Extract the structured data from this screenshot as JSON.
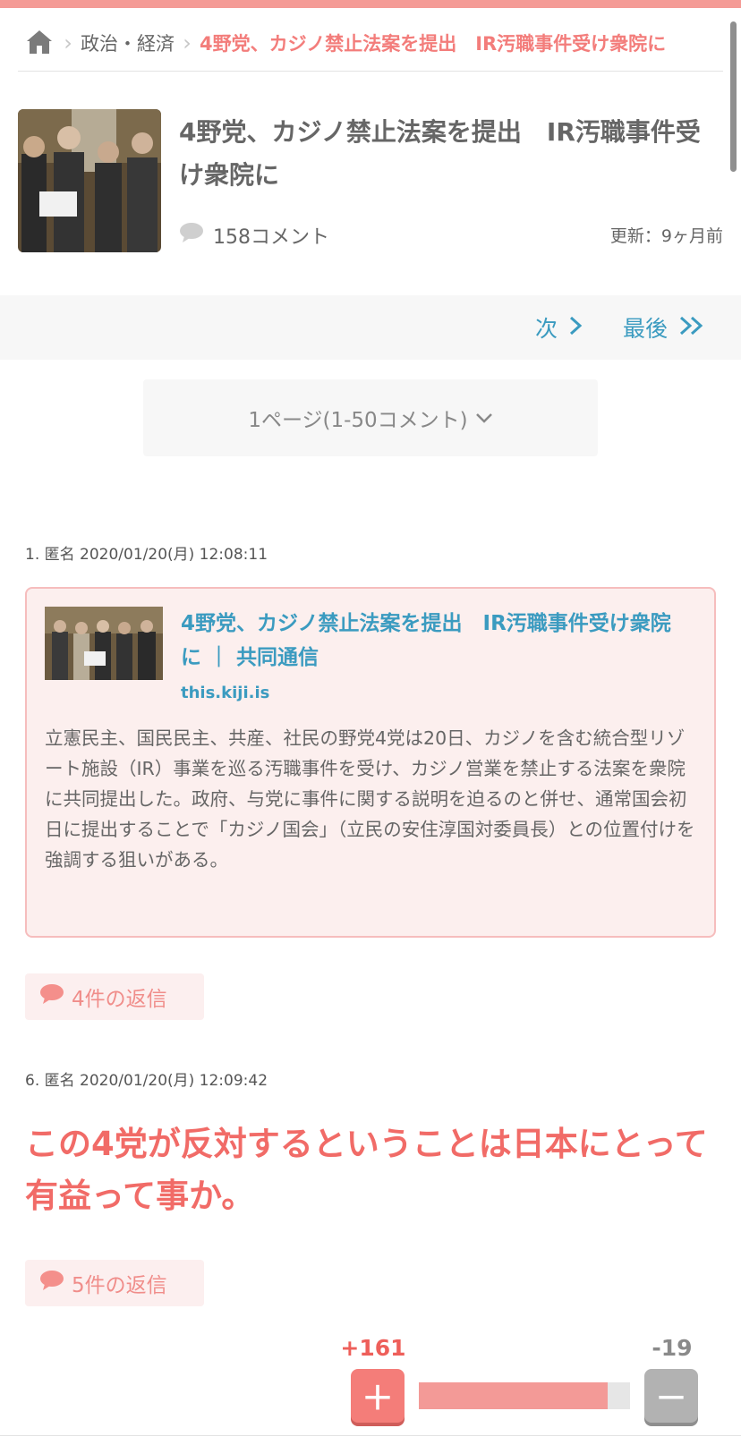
{
  "breadcrumb": {
    "category": "政治・経済",
    "current": "4野党、カジノ禁止法案を提出　IR汚職事件受け衆院に"
  },
  "article": {
    "title": "4野党、カジノ禁止法案を提出　IR汚職事件受け衆院に",
    "comment_count": "158コメント",
    "updated": "更新：9ヶ月前"
  },
  "pager": {
    "next": "次",
    "last": "最後",
    "page_select": "1ページ(1-50コメント)"
  },
  "comments": [
    {
      "meta": "1. 匿名 2020/01/20(月) 12:08:11",
      "link_card": {
        "title": "4野党、カジノ禁止法案を提出　IR汚職事件受け衆院に ｜ 共同通信",
        "source": "this.kiji.is",
        "body": "立憲民主、国民民主、共産、社民の野党4党は20日、カジノを含む統合型リゾート施設（IR）事業を巡る汚職事件を受け、カジノ営業を禁止する法案を衆院に共同提出した。政府、与党に事件に関する説明を迫るのと併せ、通常国会初日に提出することで「カジノ国会」（立民の安住淳国対委員長）との位置付けを強調する狙いがある。"
      },
      "replies": "4件の返信"
    },
    {
      "meta": "6. 匿名 2020/01/20(月) 12:09:42",
      "text": "この4党が反対するということは日本にとって有益って事か。",
      "replies": "5件の返信",
      "vote_plus": "+161",
      "vote_minus": "-19",
      "plus_ratio": 0.894
    }
  ],
  "colors": {
    "accent": "#f37d7b",
    "link": "#3b9bc0",
    "card_bg": "#fcefee"
  },
  "icons": [
    "home-icon",
    "chevron-right-icon",
    "speech-bubble-icon",
    "double-chevron-right-icon",
    "chevron-down-icon",
    "plus-icon",
    "minus-icon"
  ]
}
